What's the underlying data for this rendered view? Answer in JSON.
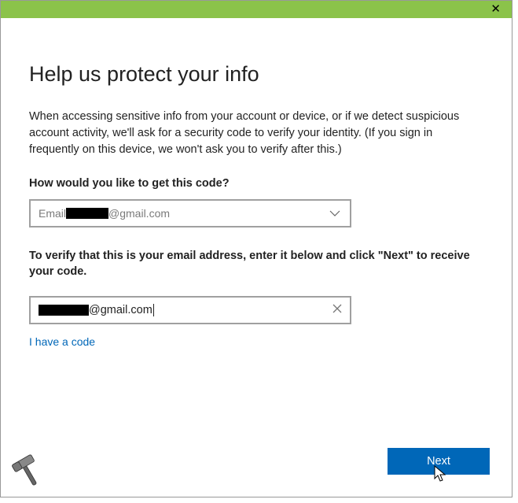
{
  "titlebar": {
    "close": "✕"
  },
  "heading": "Help us protect your info",
  "description": "When accessing sensitive info from your account or device, or if we detect suspicious account activity, we'll ask for a security code to verify your identity. (If you sign in frequently on this device, we won't ask you to verify after this.)",
  "method_label": "How would you like to get this code?",
  "select": {
    "prefix": "Email ",
    "masked_domain": "@gmail.com"
  },
  "verify_label": "To verify that this is your email address, enter it below and click \"Next\" to receive your code.",
  "input": {
    "value_domain": "@gmail.com"
  },
  "link": "I have a code",
  "next": "Next"
}
